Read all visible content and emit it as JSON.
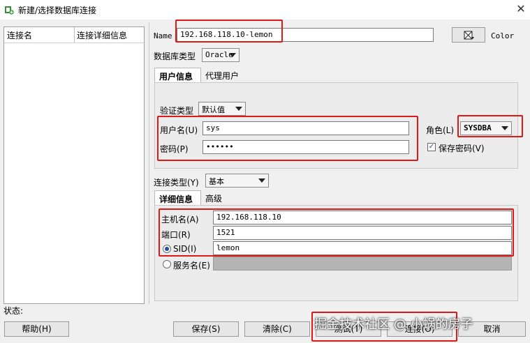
{
  "window": {
    "title": "新建/选择数据库连接",
    "close_glyph": "✕"
  },
  "list": {
    "col_name": "连接名",
    "col_detail": "连接详细信息"
  },
  "form": {
    "name_label": "Name",
    "name_value": "192.168.118.10-lemon",
    "color_label": "Color",
    "dbtype_label": "数据库类型",
    "dbtype_value": "Oracle",
    "tabs": {
      "user_info": "用户信息",
      "proxy_user": "代理用户"
    },
    "auth_type_label": "验证类型",
    "auth_type_value": "默认值",
    "username_label": "用户名(U)",
    "username_value": "sys",
    "password_label": "密码(P)",
    "password_value": "••••••",
    "role_label": "角色(L)",
    "role_value": "SYSDBA",
    "save_password_label": "保存密码(V)",
    "save_password_checked": true,
    "conn_type_label": "连接类型(Y)",
    "conn_type_value": "基本",
    "detail_tabs": {
      "details": "详细信息",
      "advanced": "高级"
    },
    "host_label": "主机名(A)",
    "host_value": "192.168.118.10",
    "port_label": "端口(R)",
    "port_value": "1521",
    "sid_label": "SID(I)",
    "sid_value": "lemon",
    "service_label": "服务名(E)",
    "service_value": ""
  },
  "status": {
    "label": "状态:"
  },
  "buttons": {
    "help": "帮助(H)",
    "save": "保存(S)",
    "clear": "清除(C)",
    "test": "测试(T)",
    "connect": "连接(O)",
    "cancel": "取消"
  },
  "watermark": "掘金技术社区 @ 小蜗的房子",
  "colors": {
    "highlight": "#e01818",
    "accent": "#1a4fa0"
  }
}
